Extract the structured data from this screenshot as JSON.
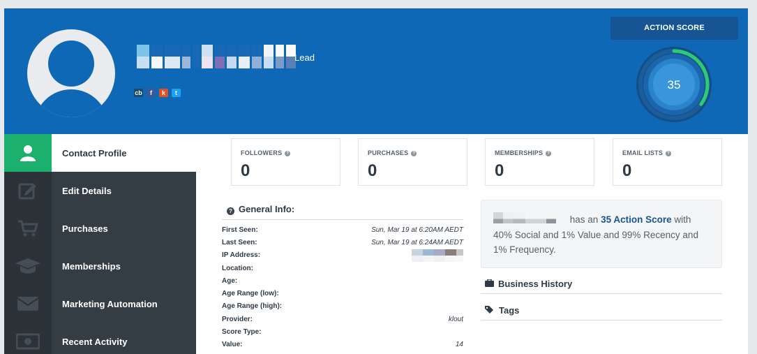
{
  "header": {
    "lead_label": "Lead",
    "action_score_label": "ACTION SCORE",
    "action_score_value": "35",
    "action_score_fraction": 0.35,
    "socials": [
      {
        "name": "crunchbase-icon",
        "glyph": "cb",
        "color": "#1b4a6b"
      },
      {
        "name": "facebook-icon",
        "glyph": "f",
        "color": "#3b5998"
      },
      {
        "name": "klout-icon",
        "glyph": "k",
        "color": "#e44f1d"
      },
      {
        "name": "twitter-icon",
        "glyph": "t",
        "color": "#1da1f2"
      }
    ]
  },
  "sidebar": {
    "items": [
      {
        "label": "Contact Profile"
      },
      {
        "label": "Edit Details"
      },
      {
        "label": "Purchases"
      },
      {
        "label": "Memberships"
      },
      {
        "label": "Marketing Automation"
      },
      {
        "label": "Recent Activity"
      }
    ]
  },
  "stats": [
    {
      "label": "FOLLOWERS",
      "value": "0"
    },
    {
      "label": "PURCHASES",
      "value": "0"
    },
    {
      "label": "MEMBERSHIPS",
      "value": "0"
    },
    {
      "label": "EMAIL LISTS",
      "value": "0"
    }
  ],
  "general_info": {
    "title": "General Info:",
    "rows": [
      {
        "key": "First Seen:",
        "value": "Sun, Mar 19 at 6:20AM AEDT"
      },
      {
        "key": "Last Seen:",
        "value": "Sun, Mar 19 at 6:24AM AEDT"
      },
      {
        "key": "IP Address:",
        "value": ""
      },
      {
        "key": "Location:",
        "value": ""
      },
      {
        "key": "Age:",
        "value": ""
      },
      {
        "key": "Age Range (low):",
        "value": ""
      },
      {
        "key": "Age Range (high):",
        "value": ""
      },
      {
        "key": "Provider:",
        "value": "klout"
      },
      {
        "key": "Score Type:",
        "value": ""
      },
      {
        "key": "Value:",
        "value": "14"
      }
    ]
  },
  "summary": {
    "prefix": "has an",
    "score_text": "35 Action Score",
    "suffix": "with 40% Social and 1% Value and 99% Recency and 1% Frequency."
  },
  "sections": {
    "business_history": "Business History",
    "tags": "Tags"
  },
  "colors": {
    "header_blue": "#0f68b5",
    "active_green": "#1bb06e",
    "sidebar_dark": "#343c44",
    "gauge_green": "#2ecc71"
  }
}
